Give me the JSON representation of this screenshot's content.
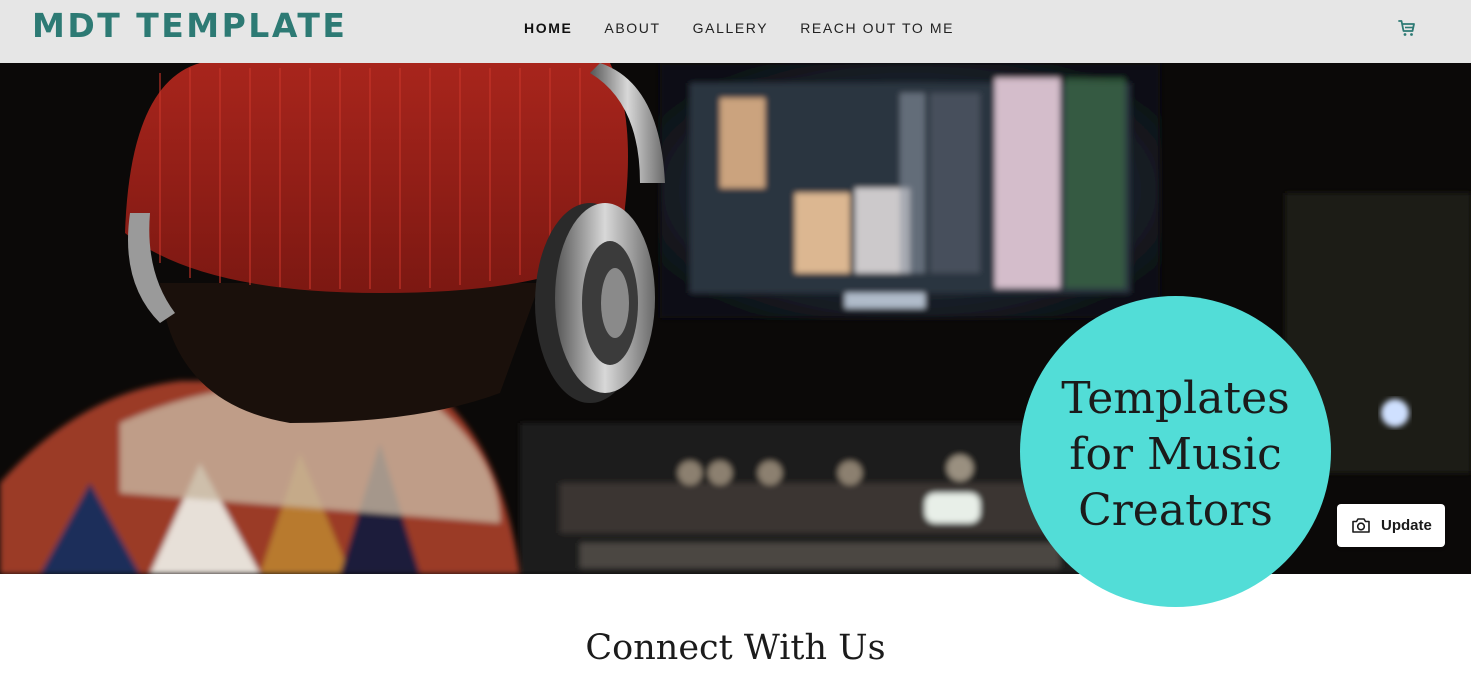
{
  "header": {
    "logo": "MDT TEMPLATE",
    "nav": [
      {
        "label": "HOME",
        "active": true
      },
      {
        "label": "ABOUT",
        "active": false
      },
      {
        "label": "GALLERY",
        "active": false
      },
      {
        "label": "REACH OUT TO ME",
        "active": false
      }
    ],
    "cart_icon": "cart-icon"
  },
  "hero": {
    "headline": "Templates for Music Creators",
    "update_button": "Update",
    "update_icon": "camera-icon"
  },
  "section": {
    "title": "Connect With Us"
  },
  "colors": {
    "brand": "#2d7a74",
    "accent": "#52ddd7",
    "header_bg": "#e6e6e6"
  }
}
